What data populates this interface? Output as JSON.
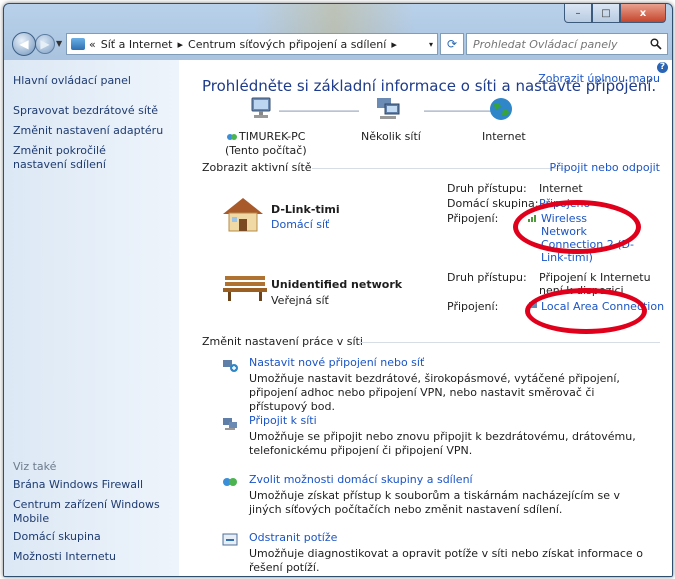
{
  "window": {
    "min": "–",
    "max": "□",
    "close": "x"
  },
  "address": {
    "recent": "▼",
    "sep": "«",
    "crumb1": "Síť a Internet",
    "arrow1": "▸",
    "crumb2": "Centrum síťových připojení a sdílení",
    "arrow2": "▸",
    "dropdown": "▾"
  },
  "search": {
    "placeholder": "Prohledat Ovládací panely"
  },
  "sidebar": {
    "home": "Hlavní ovládací panel",
    "items": [
      "Spravovat bezdrátové sítě",
      "Změnit nastavení adaptéru",
      "Změnit pokročilé nastavení sdílení"
    ],
    "see_also": "Viz také",
    "see_also_items": [
      "Brána Windows Firewall",
      "Centrum zařízení Windows Mobile",
      "Domácí skupina",
      "Možnosti Internetu"
    ]
  },
  "main": {
    "title": "Prohlédněte si základní informace o síti a nastavte připojení.",
    "full_map": "Zobrazit úplnou mapu",
    "map": {
      "pc_name": "TIMUREK-PC",
      "pc_sub": "(Tento počítač)",
      "networks": "Několik sítí",
      "internet": "Internet"
    },
    "active_label": "Zobrazit aktivní sítě",
    "connect_link": "Připojit nebo odpojit",
    "net1": {
      "name": "D-Link-timi",
      "type": "Domácí síť",
      "access_label": "Druh přístupu:",
      "access": "Internet",
      "hg_label": "Domácí skupina:",
      "hg": "Připojeno",
      "conn_label": "Připojení:",
      "conn": "Wireless Network Connection 2 (D-Link-timi)"
    },
    "net2": {
      "name": "Unidentified network",
      "type": "Veřejná síť",
      "access_label": "Druh přístupu:",
      "access": "Připojení k Internetu není k dispozici",
      "conn_label": "Připojení:",
      "conn": "Local Area Connection"
    },
    "change_label": "Změnit nastavení práce v síti",
    "tasks": [
      {
        "title": "Nastavit nové připojení nebo síť",
        "desc": "Umožňuje nastavit bezdrátové, širokopásmové, vytáčené připojení, připojení adhoc nebo připojení VPN, nebo nastavit směrovač či přístupový bod."
      },
      {
        "title": "Připojit k síti",
        "desc": "Umožňuje se připojit nebo znovu připojit k bezdrátovému, drátovému, telefonickému připojení či připojení VPN."
      },
      {
        "title": "Zvolit možnosti domácí skupiny a sdílení",
        "desc": "Umožňuje získat přístup k souborům a tiskárnám nacházejícím se v jiných síťových počítačích nebo změnit nastavení sdílení."
      },
      {
        "title": "Odstranit potíže",
        "desc": "Umožňuje diagnostikovat a opravit potíže v síti nebo získat informace o řešení potíží."
      }
    ]
  },
  "colors": {
    "link": "#1b55c5",
    "heading": "#1e3b8c",
    "annotation": "#e0001b"
  },
  "icons": [
    "back-arrow-icon",
    "forward-arrow-icon",
    "refresh-icon",
    "search-icon",
    "help-icon",
    "computer-icon",
    "network-icon",
    "globe-icon",
    "house-icon",
    "bench-icon"
  ]
}
